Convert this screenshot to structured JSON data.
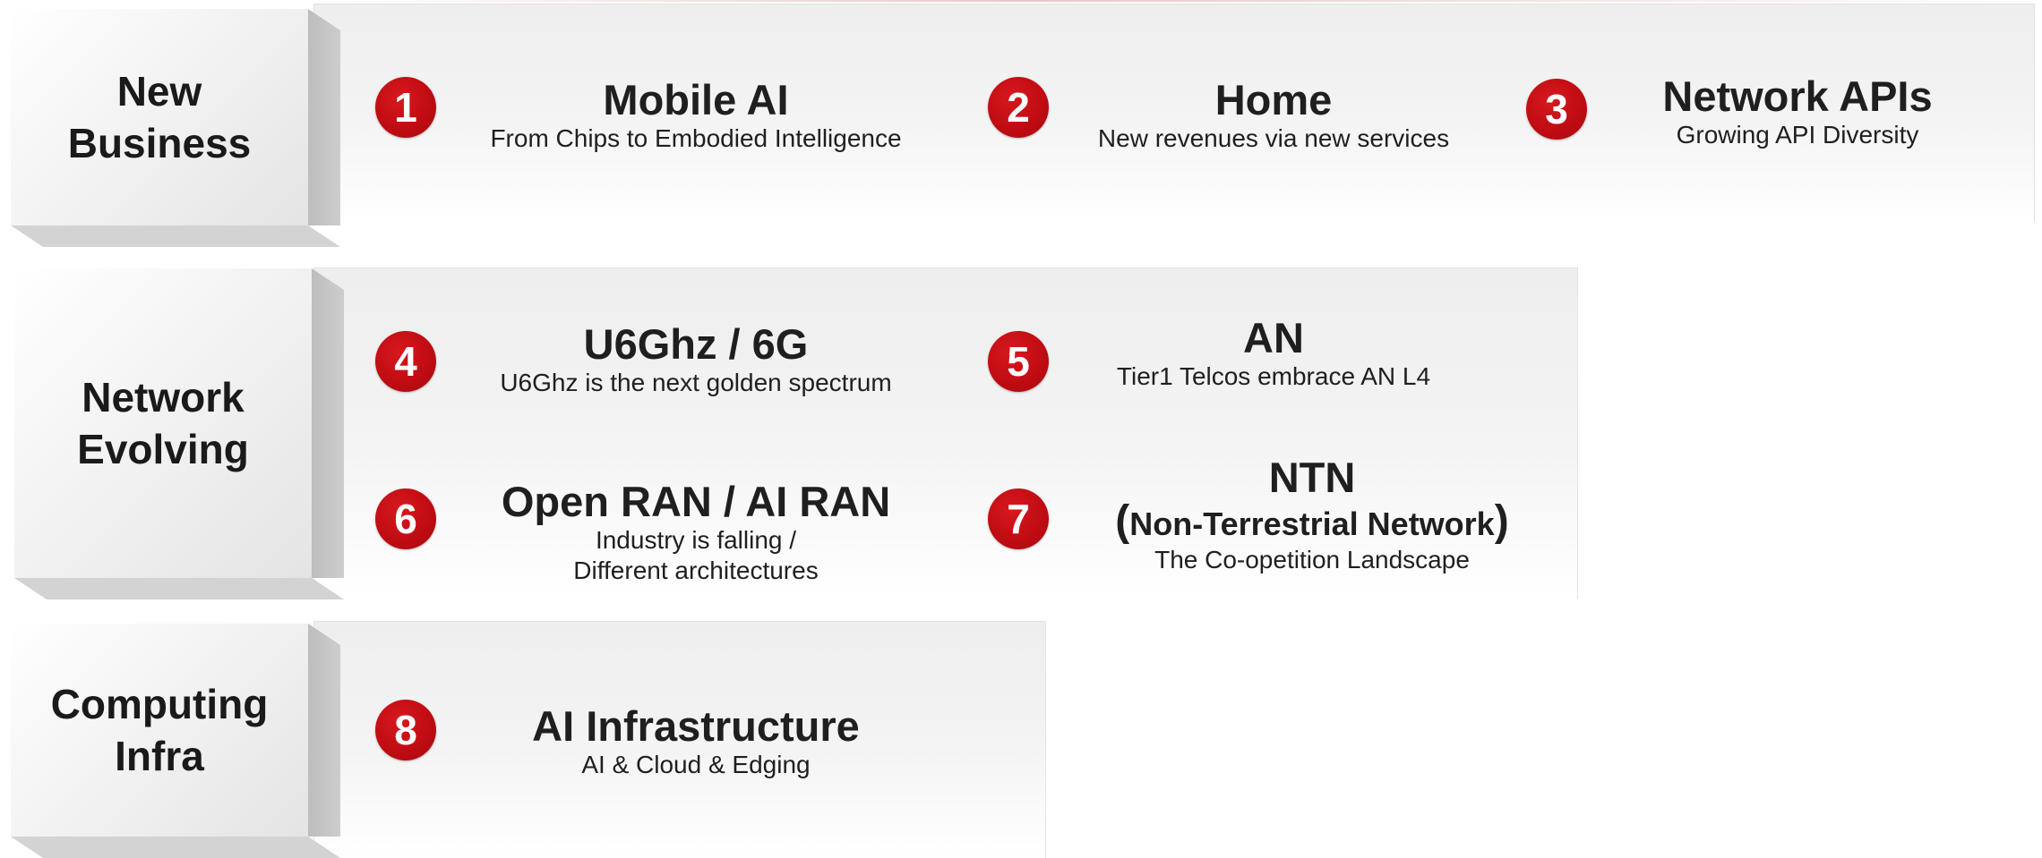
{
  "categories": [
    {
      "label_line1": "New",
      "label_line2": "Business"
    },
    {
      "label_line1": "Network",
      "label_line2": "Evolving"
    },
    {
      "label_line1": "Computing",
      "label_line2": "Infra"
    }
  ],
  "items": [
    {
      "number": "1",
      "title": "Mobile AI",
      "subtitle": "From Chips to Embodied Intelligence"
    },
    {
      "number": "2",
      "title": "Home",
      "subtitle": "New revenues via new services"
    },
    {
      "number": "3",
      "title": "Network APIs",
      "subtitle": "Growing API Diversity"
    },
    {
      "number": "4",
      "title": "U6Ghz / 6G",
      "subtitle": "U6Ghz is the next golden spectrum"
    },
    {
      "number": "5",
      "title": "AN",
      "subtitle": "Tier1 Telcos embrace AN L4"
    },
    {
      "number": "6",
      "title": "Open RAN / AI RAN",
      "subtitle_line1": "Industry is falling /",
      "subtitle_line2": "Different architectures"
    },
    {
      "number": "7",
      "title": "NTN",
      "title_line2_open": "(",
      "title_line2": "Non-Terrestrial Network",
      "title_line2_close": ")",
      "subtitle": "The Co-opetition Landscape"
    },
    {
      "number": "8",
      "title": "AI Infrastructure",
      "subtitle": "AI & Cloud & Edging"
    }
  ],
  "colors": {
    "badge": "#c0121a",
    "panel": "#f0f0f0",
    "text": "#1a1a1a"
  }
}
